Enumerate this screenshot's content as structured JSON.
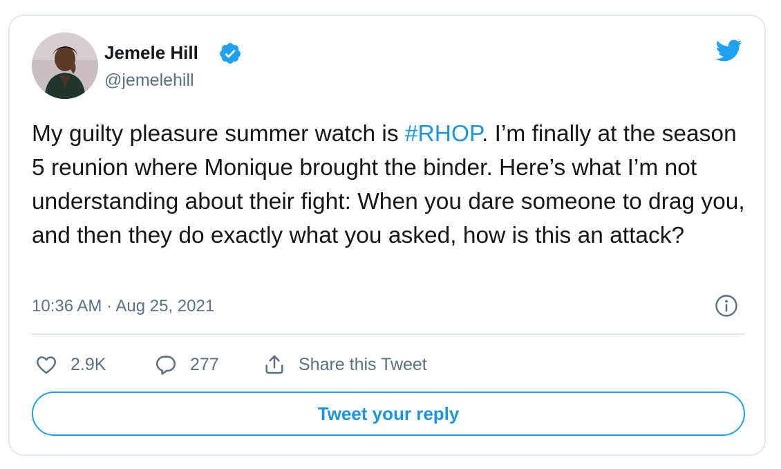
{
  "author": {
    "display_name": "Jemele Hill",
    "handle": "@jemelehill",
    "verified": true
  },
  "tweet": {
    "text_before_hashtag": "My guilty pleasure summer watch is ",
    "hashtag": "#RHOP",
    "text_after_hashtag": ". I’m finally at the season 5 reunion where Monique brought the binder. Here’s what I’m not understanding about their fight: When you dare someone to drag you, and then they do exactly what you asked, how is this an attack?",
    "timestamp": "10:36 AM · Aug 25, 2021"
  },
  "actions": {
    "likes": "2.9K",
    "replies": "277",
    "share_label": "Share this Tweet"
  },
  "reply_button_label": "Tweet your reply",
  "icons": {
    "verified": "verified-badge-icon",
    "brand": "twitter-bird-icon",
    "info": "info-icon",
    "like": "heart-icon",
    "reply": "speech-bubble-icon",
    "share": "share-icon"
  },
  "colors": {
    "accent": "#1da1f2",
    "link": "#1b95e0",
    "text": "#14171a",
    "secondary_text": "#5b7083",
    "border": "#e1e8ed"
  }
}
